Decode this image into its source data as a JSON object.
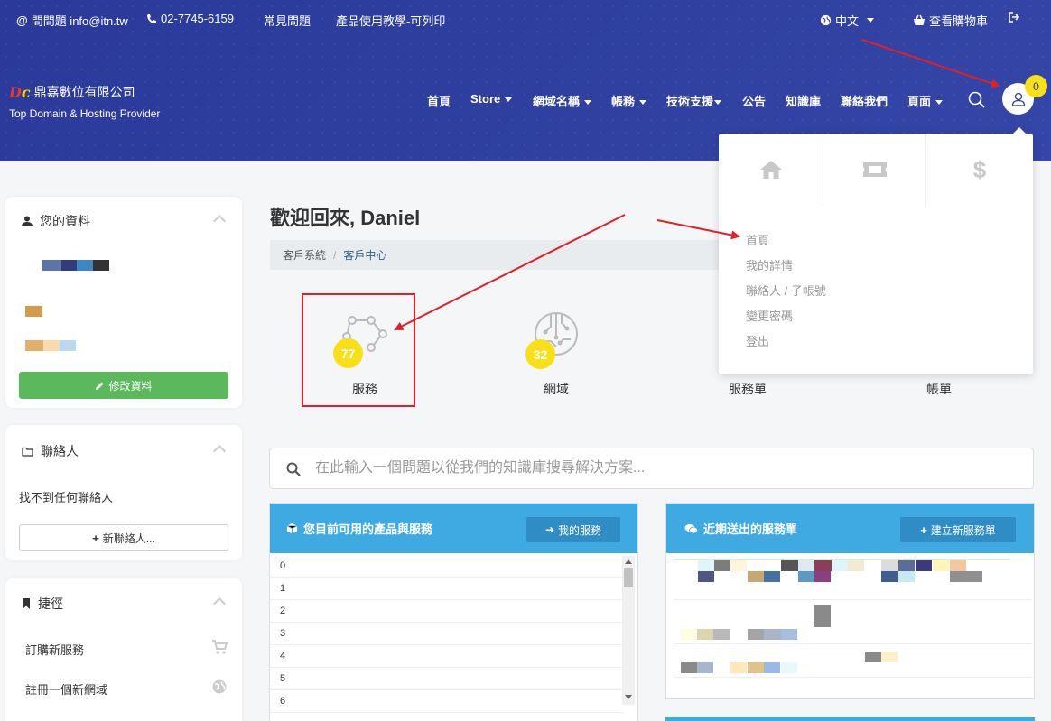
{
  "topbar": {
    "email": "問問題 info@itn.tw",
    "phone": "02-7745-6159",
    "faq": "常見問題",
    "tutorial": "產品使用教學-可列印",
    "language": "中文",
    "cart": "查看購物車"
  },
  "brand": {
    "company": "鼎嘉數位有限公司",
    "tagline": "Top Domain & Hosting Provider"
  },
  "nav": {
    "items": [
      {
        "label": "首頁"
      },
      {
        "label": "Store"
      },
      {
        "label": "網域名稱"
      },
      {
        "label": "帳務"
      },
      {
        "label": "技術支援"
      },
      {
        "label": "公告"
      },
      {
        "label": "知識庫"
      },
      {
        "label": "聯絡我們"
      },
      {
        "label": "頁面"
      }
    ],
    "cart_count": "0"
  },
  "sidebar": {
    "profile_title": "您的資料",
    "edit_profile": "修改資料",
    "contacts_title": "聯絡人",
    "no_contacts": "找不到任何聯絡人",
    "new_contact": "新聯絡人...",
    "shortcuts_title": "捷徑",
    "shortcuts": [
      {
        "label": "訂購新服務"
      },
      {
        "label": "註冊一個新網域"
      }
    ]
  },
  "main": {
    "welcome": "歡迎回來, Daniel",
    "breadcrumb": [
      "客戶系統",
      "客戶中心"
    ],
    "stats": [
      {
        "label": "服務",
        "count": "77"
      },
      {
        "label": "網域",
        "count": "32"
      },
      {
        "label": "服務單",
        "count": ""
      },
      {
        "label": "帳單",
        "count": ""
      }
    ],
    "kb_placeholder": "在此輸入一個問題以從我們的知識庫搜尋解決方案..."
  },
  "products_card": {
    "title": "您目前可用的產品與服務",
    "button": "我的服務",
    "rows": [
      "0",
      "1",
      "2",
      "3",
      "4",
      "5",
      "6"
    ]
  },
  "tickets_card": {
    "title": "近期送出的服務單",
    "button": "建立新服務單"
  },
  "user_menu": {
    "items": [
      {
        "label": "首頁"
      },
      {
        "label": "我的詳情"
      },
      {
        "label": "聯絡人 / 子帳號"
      },
      {
        "label": "變更密碼"
      },
      {
        "label": "登出"
      }
    ]
  },
  "colors": {
    "header": "#2e3f9f",
    "accent": "#3fa9e2",
    "badge": "#f7e017",
    "success": "#5cb85c",
    "annotation": "#e21f26"
  }
}
